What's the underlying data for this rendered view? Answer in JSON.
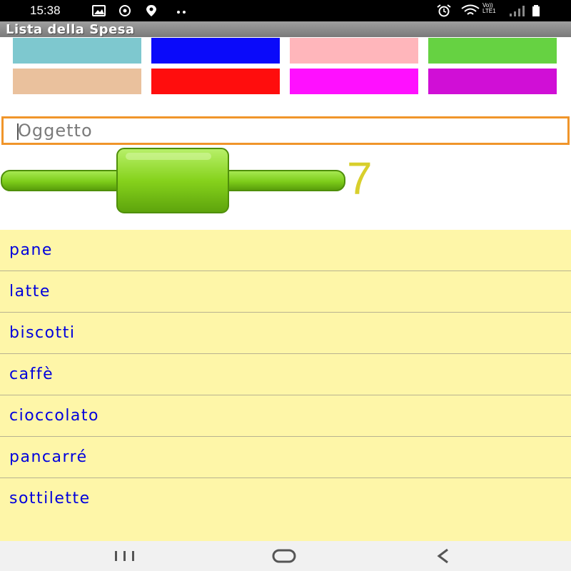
{
  "status_bar": {
    "time": "15:38",
    "network_label_top": "Vo))",
    "network_label_bottom": "LTE1"
  },
  "app": {
    "title": "Lista della Spesa"
  },
  "color_palette": [
    "#7ec8cf",
    "#0a0afa",
    "#ffb6bb",
    "#66d242",
    "#eac19d",
    "#ff0d0d",
    "#ff10ff",
    "#d00fd6"
  ],
  "item_input": {
    "placeholder": "Oggetto",
    "value": ""
  },
  "add_button": {
    "icon": "plus-icon",
    "color": "#7dcd1a"
  },
  "item_count": "7",
  "shopping_list": {
    "items": [
      {
        "label": "pane"
      },
      {
        "label": "latte"
      },
      {
        "label": "biscotti"
      },
      {
        "label": "caffè"
      },
      {
        "label": "cioccolato"
      },
      {
        "label": "pancarré"
      },
      {
        "label": "sottilette"
      }
    ]
  },
  "navigation": {
    "recents": "recents-icon",
    "home": "home-icon",
    "back": "back-icon"
  }
}
